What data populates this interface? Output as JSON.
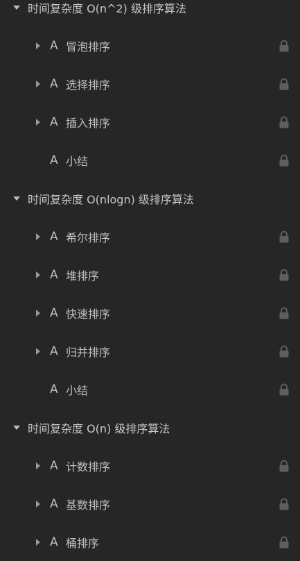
{
  "sections": [
    {
      "title": "时间复杂度 O(n^2) 级排序算法",
      "items": [
        {
          "icon_text": "A",
          "label": "冒泡排序",
          "expandable": true,
          "locked": true
        },
        {
          "icon_text": "A",
          "label": "选择排序",
          "expandable": true,
          "locked": true
        },
        {
          "icon_text": "A",
          "label": "插入排序",
          "expandable": true,
          "locked": true
        },
        {
          "icon_text": "A",
          "label": "小结",
          "expandable": false,
          "locked": true
        }
      ]
    },
    {
      "title": "时间复杂度 O(nlogn) 级排序算法",
      "items": [
        {
          "icon_text": "A",
          "label": "希尔排序",
          "expandable": true,
          "locked": true
        },
        {
          "icon_text": "A",
          "label": "堆排序",
          "expandable": true,
          "locked": true
        },
        {
          "icon_text": "A",
          "label": "快速排序",
          "expandable": true,
          "locked": true
        },
        {
          "icon_text": "A",
          "label": "归并排序",
          "expandable": true,
          "locked": true
        },
        {
          "icon_text": "A",
          "label": "小结",
          "expandable": false,
          "locked": true
        }
      ]
    },
    {
      "title": "时间复杂度 O(n) 级排序算法",
      "items": [
        {
          "icon_text": "A",
          "label": "计数排序",
          "expandable": true,
          "locked": true
        },
        {
          "icon_text": "A",
          "label": "基数排序",
          "expandable": true,
          "locked": true
        },
        {
          "icon_text": "A",
          "label": "桶排序",
          "expandable": true,
          "locked": true
        }
      ]
    }
  ],
  "icons": {
    "section_toggle": "caret-down-icon",
    "item_toggle": "caret-right-icon",
    "lock": "lock-icon"
  },
  "colors": {
    "background": "#262626",
    "text": "#c0c0c0",
    "lock": "#5e5e5e"
  }
}
